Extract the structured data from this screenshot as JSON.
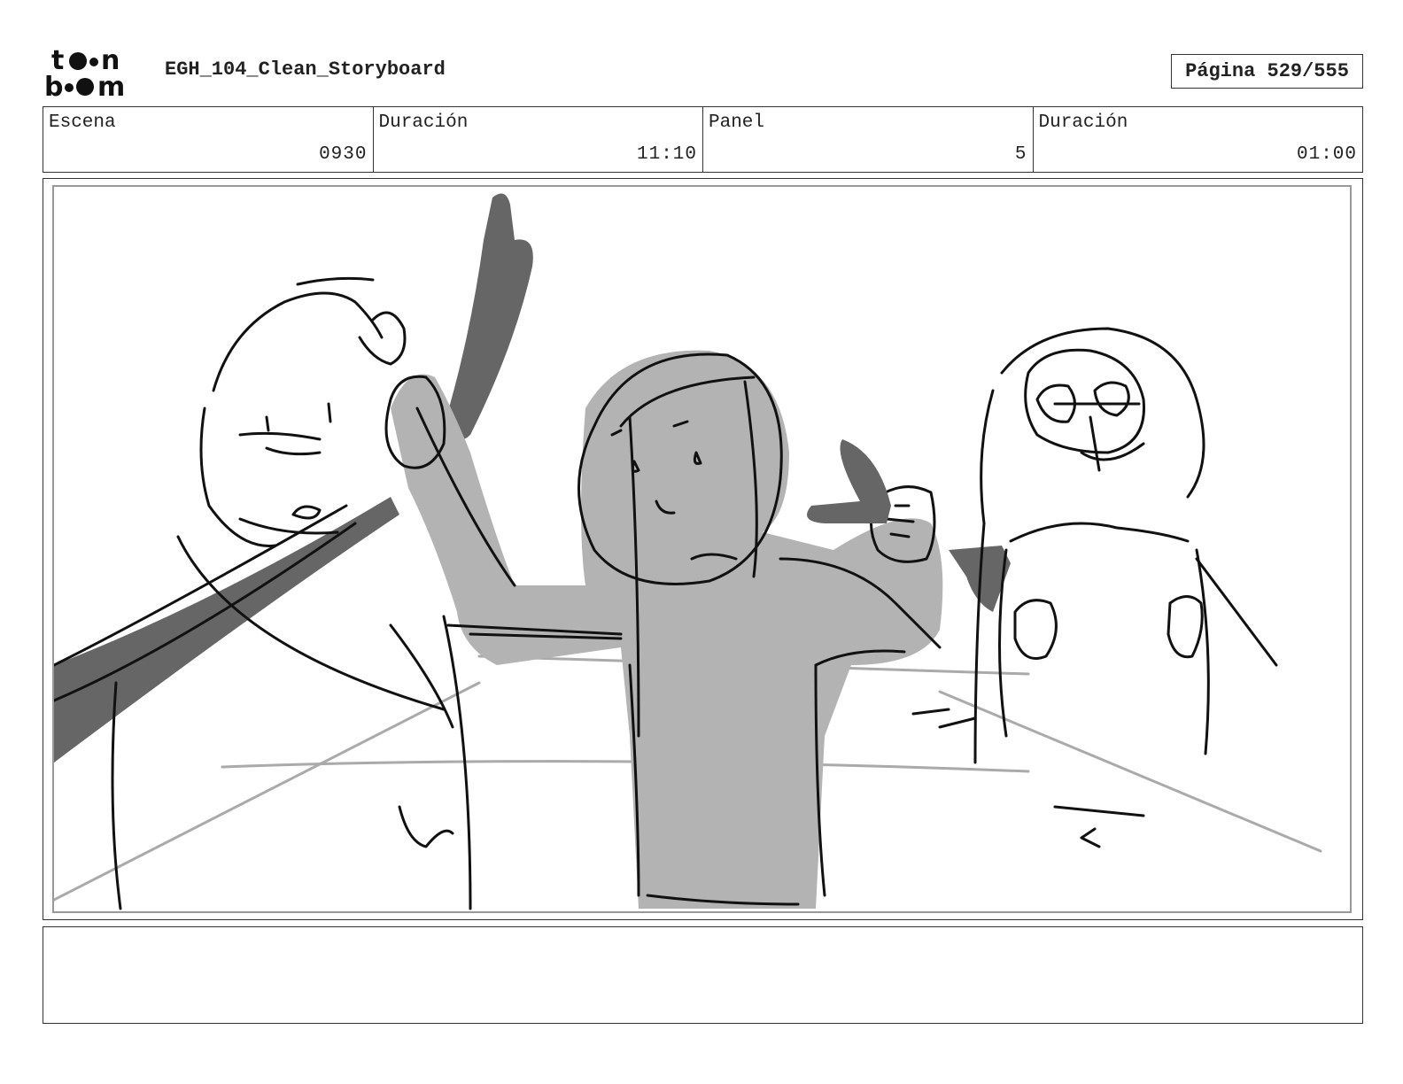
{
  "header": {
    "logo_text": "toon boom",
    "title": "EGH_104_Clean_Storyboard",
    "page_label": "Página 529/555"
  },
  "info": [
    {
      "label": "Escena",
      "value": "0930"
    },
    {
      "label": "Duración",
      "value": "11:10"
    },
    {
      "label": "Panel",
      "value": "5"
    },
    {
      "label": "Duración",
      "value": "01:00"
    }
  ],
  "notes": {
    "text": ""
  }
}
